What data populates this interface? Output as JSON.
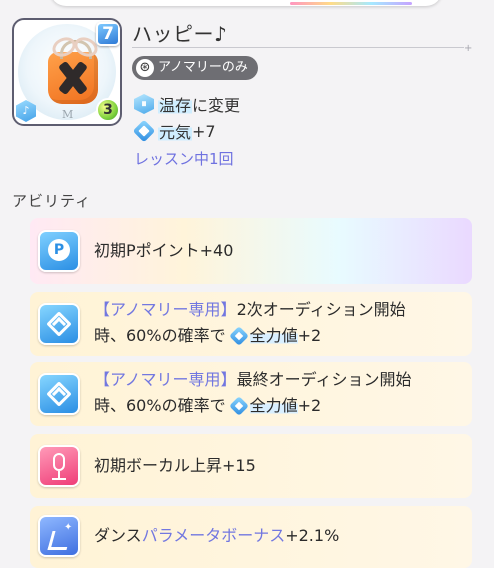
{
  "card": {
    "name": "ハッピー♪",
    "cost": "7",
    "type_icon": "sense-type-icon",
    "rarity_letter": "M",
    "level": "3",
    "tag": "アノマリーのみ",
    "effects": [
      {
        "icon": "hex-blue-icon",
        "text": "温存",
        "suffix": "に変更"
      },
      {
        "icon": "diamond-blue-icon",
        "text": "元気",
        "suffix": "+7"
      }
    ],
    "lesson_note": "レッスン中1回"
  },
  "abilities": {
    "section_title": "アビリティ",
    "items": [
      {
        "icon": "p-point-icon",
        "line1": "初期Pポイント+40"
      },
      {
        "icon": "chevron-up-icon",
        "tag": "【アノマリー専用】",
        "line1_rest": "2次オーディション開始",
        "line2_prefix": "時、60%の確率で",
        "stat": "全力値",
        "stat_suffix": "+2"
      },
      {
        "icon": "chevron-up-icon",
        "tag": "【アノマリー専用】",
        "line1_rest": "最終オーディション開始",
        "line2_prefix": "時、60%の確率で",
        "stat": "全力値",
        "stat_suffix": "+2"
      },
      {
        "icon": "microphone-icon",
        "line1": "初期ボーカル上昇+15"
      },
      {
        "icon": "dance-icon",
        "prefix": "ダンス",
        "highlight": "パラメータボーナス",
        "suffix": "+2.1%"
      }
    ]
  }
}
